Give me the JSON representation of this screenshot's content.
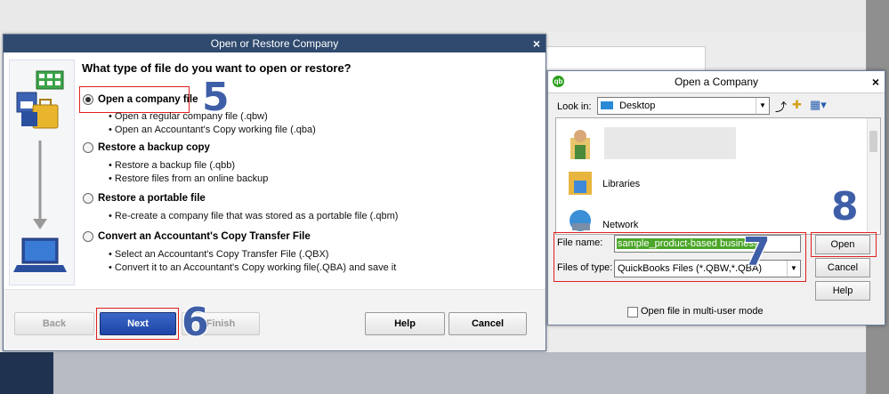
{
  "dialog1": {
    "title": "Open or Restore Company",
    "question": "What type of file do you want to open or restore?",
    "options": [
      {
        "label": "Open a company file",
        "selected": true,
        "details": [
          "Open a regular company file (.qbw)",
          "Open an Accountant's Copy working file (.qba)"
        ]
      },
      {
        "label": "Restore a backup copy",
        "selected": false,
        "details": [
          "Restore a backup file (.qbb)",
          "Restore files from an online backup"
        ]
      },
      {
        "label": "Restore a portable file",
        "selected": false,
        "details": [
          "Re-create a company file that was stored as a portable file (.qbm)"
        ]
      },
      {
        "label": "Convert an Accountant's Copy Transfer File",
        "selected": false,
        "details": [
          "Select an Accountant's Copy Transfer File (.QBX)",
          "Convert it to an Accountant's Copy working file(.QBA) and save it"
        ]
      }
    ],
    "buttons": {
      "back": "Back",
      "next": "Next",
      "finish": "Finish",
      "help": "Help",
      "cancel": "Cancel"
    }
  },
  "dialog2": {
    "title": "Open a Company",
    "look_in_label": "Look in:",
    "look_in_value": "Desktop",
    "items": [
      "Libraries",
      "Network"
    ],
    "file_name_label": "File name:",
    "file_name_value": "sample_product-based business",
    "files_of_type_label": "Files of type:",
    "files_of_type_value": "QuickBooks Files (*.QBW,*.QBA)",
    "buttons": {
      "open": "Open",
      "cancel": "Cancel",
      "help": "Help"
    },
    "multiuser_label": "Open file in multi-user mode"
  },
  "annotations": [
    "5",
    "6",
    "7",
    "8"
  ],
  "colors": {
    "title_bar": "#2f4a6e",
    "primary_button": "#2a56b8",
    "highlight_red": "#e02020",
    "annotation": "#3f5ea8",
    "selection_green": "#4aa528"
  }
}
